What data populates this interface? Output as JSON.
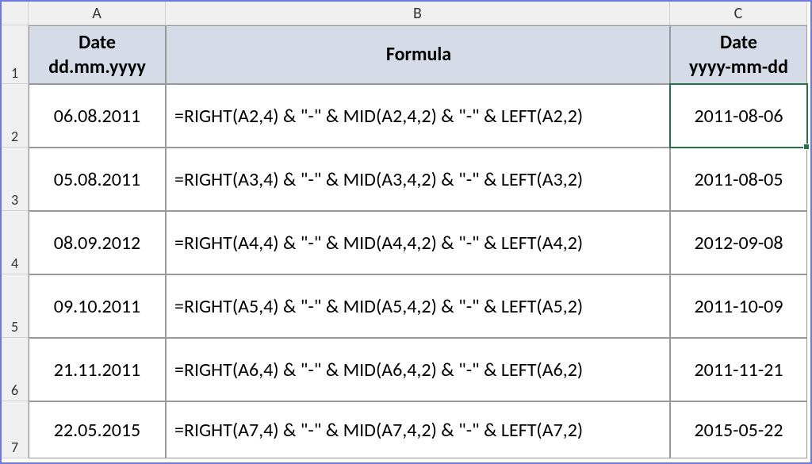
{
  "columns": [
    "A",
    "B",
    "C"
  ],
  "rowNumbers": [
    "1",
    "2",
    "3",
    "4",
    "5",
    "6",
    "7"
  ],
  "headers": {
    "a": "Date\ndd.mm.yyyy",
    "b": "Formula",
    "c": "Date\nyyyy-mm-dd"
  },
  "rows": [
    {
      "a": "06.08.2011",
      "b": "=RIGHT(A2,4) & \"-\" & MID(A2,4,2) & \"-\" & LEFT(A2,2)",
      "c": "2011-08-06"
    },
    {
      "a": "05.08.2011",
      "b": "=RIGHT(A3,4) & \"-\" & MID(A3,4,2) & \"-\" & LEFT(A3,2)",
      "c": "2011-08-05"
    },
    {
      "a": "08.09.2012",
      "b": "=RIGHT(A4,4) & \"-\" & MID(A4,4,2) & \"-\" & LEFT(A4,2)",
      "c": "2012-09-08"
    },
    {
      "a": "09.10.2011",
      "b": "=RIGHT(A5,4) & \"-\" & MID(A5,4,2) & \"-\" & LEFT(A5,2)",
      "c": "2011-10-09"
    },
    {
      "a": "21.11.2011",
      "b": "=RIGHT(A6,4) & \"-\" & MID(A6,4,2) & \"-\" & LEFT(A6,2)",
      "c": "2011-11-21"
    },
    {
      "a": "22.05.2015",
      "b": "=RIGHT(A7,4) & \"-\" & MID(A7,4,2) & \"-\" & LEFT(A7,2)",
      "c": "2015-05-22"
    }
  ],
  "activeCell": "C2"
}
